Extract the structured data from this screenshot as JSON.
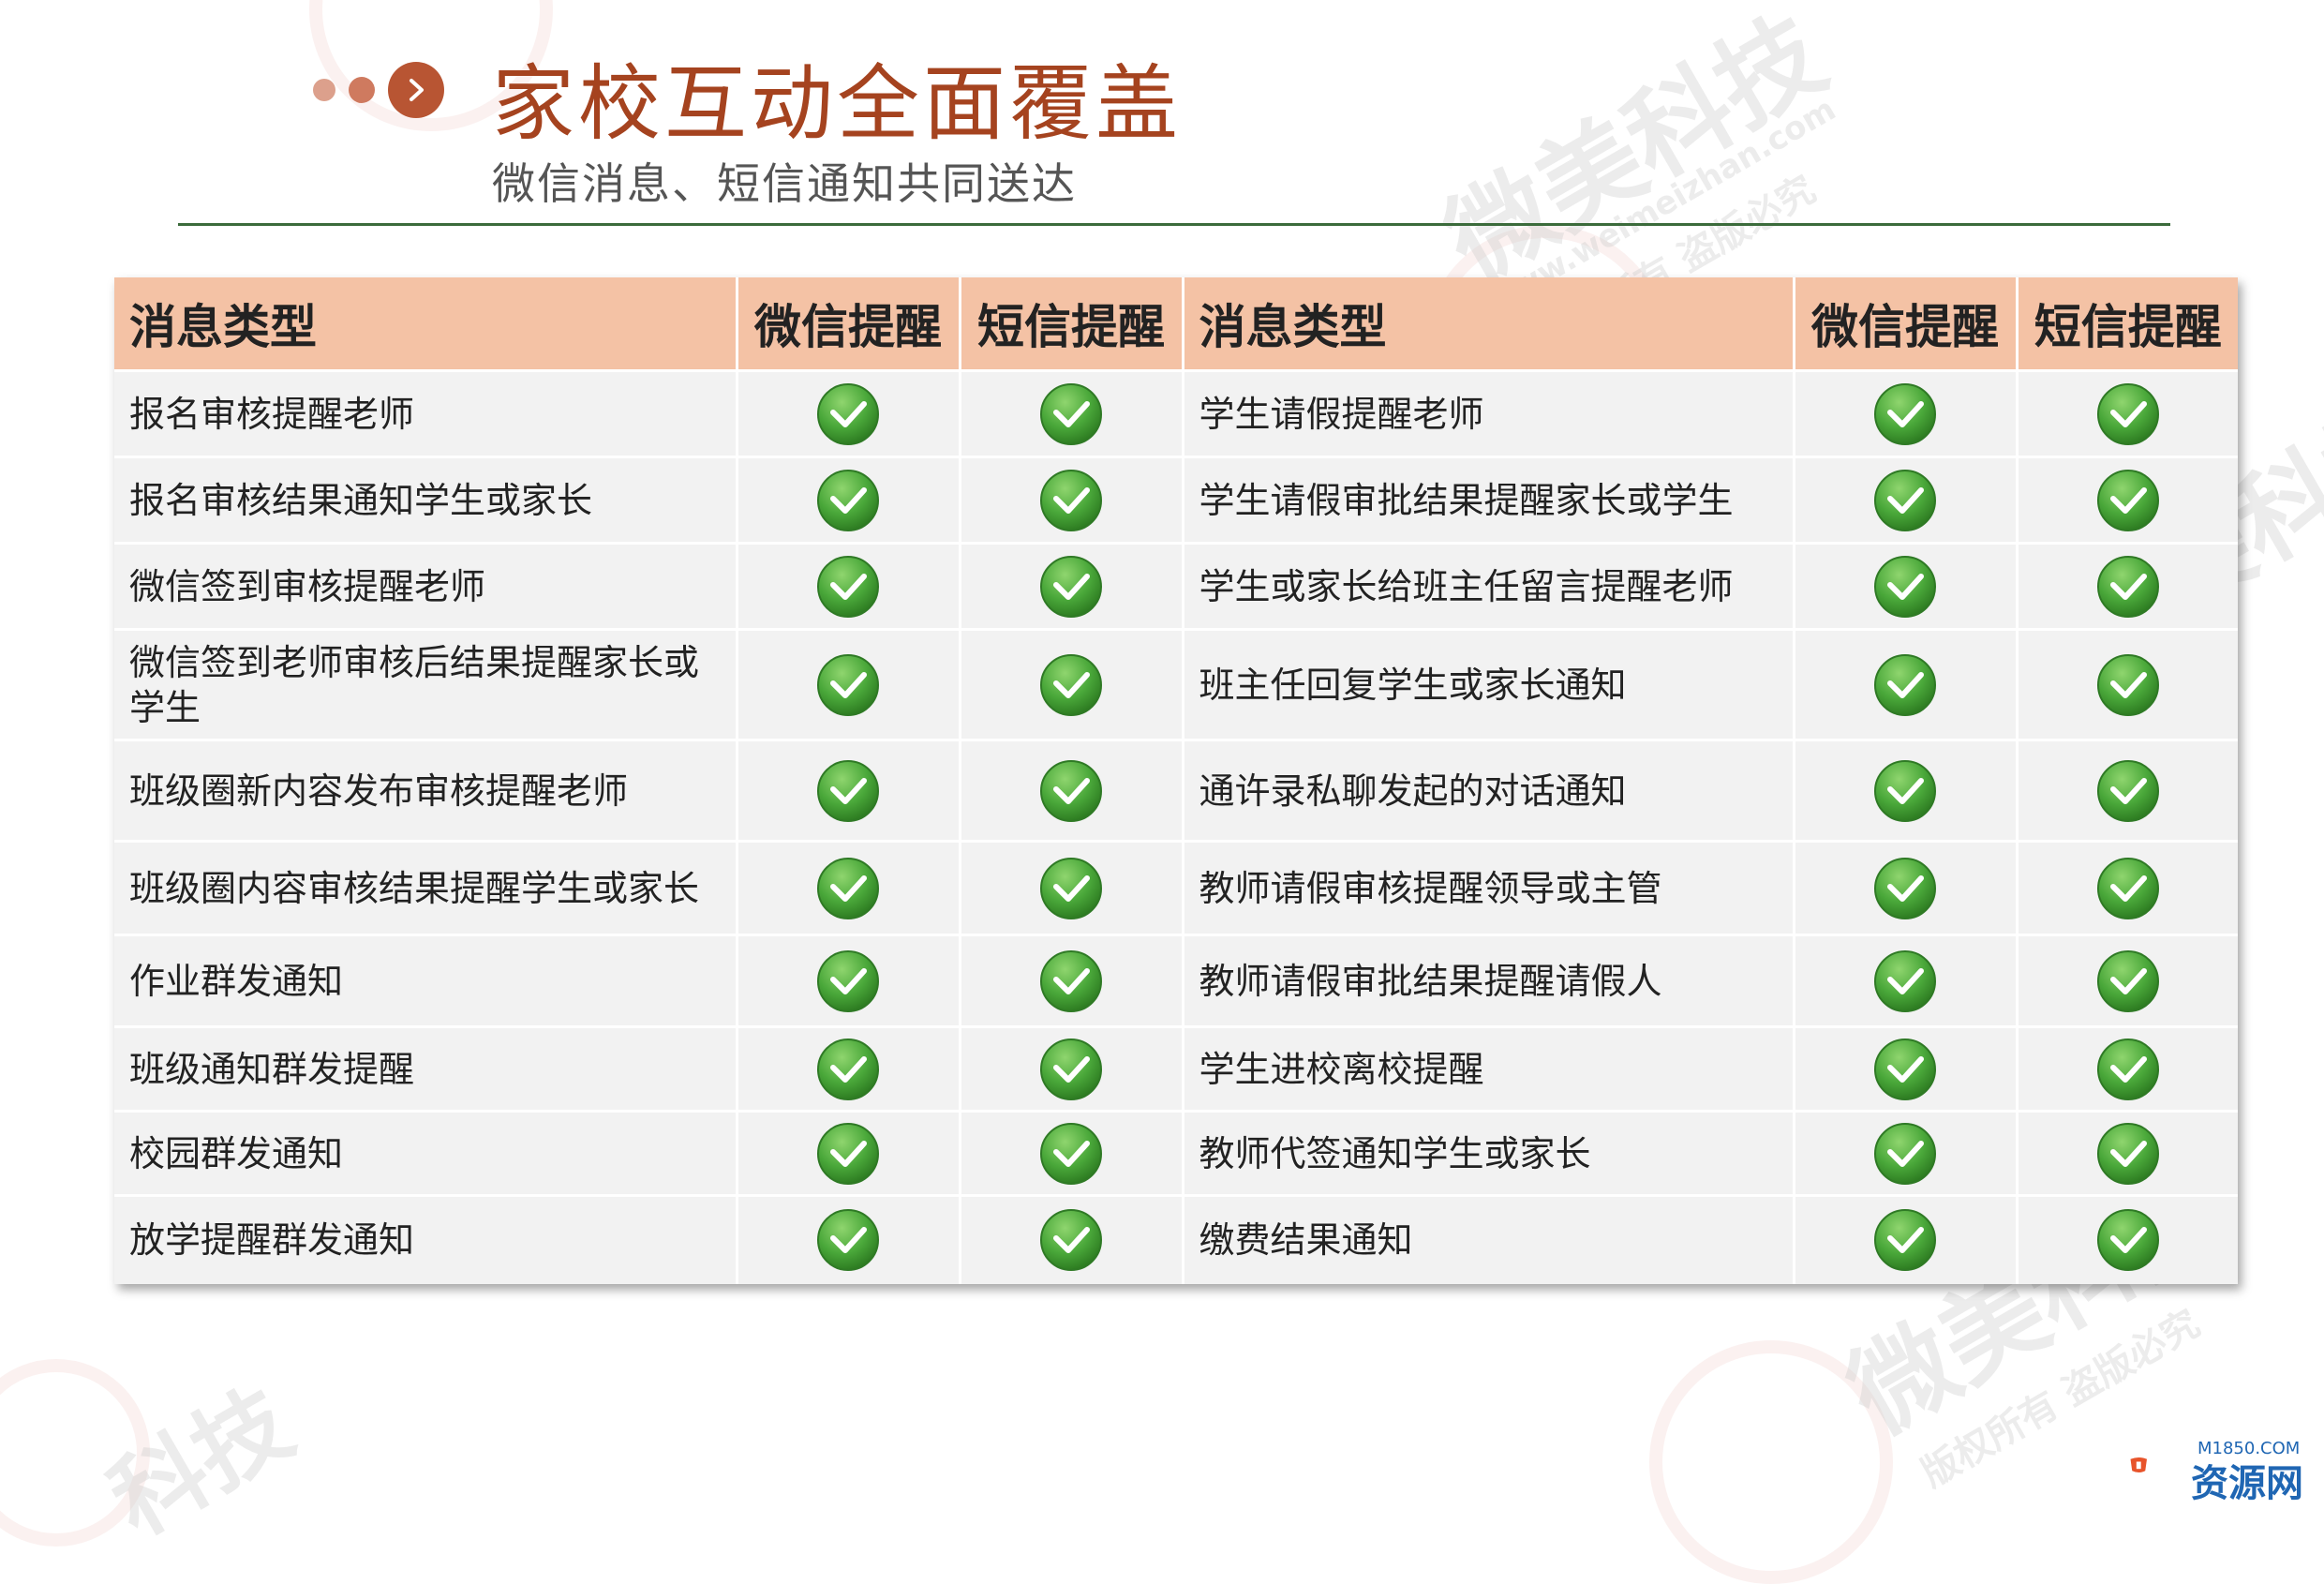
{
  "header": {
    "title": "家校互动全面覆盖",
    "subtitle": "微信消息、短信通知共同送达"
  },
  "table": {
    "headers": [
      "消息类型",
      "微信提醒",
      "短信提醒",
      "消息类型",
      "微信提醒",
      "短信提醒"
    ],
    "rows": [
      {
        "left": "报名审核提醒老师",
        "right": "学生请假提醒老师"
      },
      {
        "left": "报名审核结果通知学生或家长",
        "right": "学生请假审批结果提醒家长或学生"
      },
      {
        "left": "微信签到审核提醒老师",
        "right": "学生或家长给班主任留言提醒老师"
      },
      {
        "left": "微信签到老师审核后结果提醒家长或学生",
        "right": "班主任回复学生或家长通知"
      },
      {
        "left": "班级圈新内容发布审核提醒老师",
        "right": "通许录私聊发起的对话通知"
      },
      {
        "left": "班级圈内容审核结果提醒学生或家长",
        "right": "教师请假审核提醒领导或主管"
      },
      {
        "left": "作业群发通知",
        "right": "教师请假审批结果提醒请假人"
      },
      {
        "left": "班级通知群发提醒",
        "right": "学生进校离校提醒"
      },
      {
        "left": "校园群发通知",
        "right": "教师代签通知学生或家长"
      },
      {
        "left": "放学提醒群发通知",
        "right": "缴费结果通知"
      }
    ],
    "check_icon": "green-checkmark-icon"
  },
  "watermark": {
    "text_main": "微美科技",
    "text_url": "www.weimeizhan.com",
    "text_rights": "版权所有 盗版必究",
    "text_partial": "科技"
  },
  "corner_logo": {
    "name": "资源网",
    "url": "M1850.COM"
  },
  "colors": {
    "title": "#a5431f",
    "header_bg": "#f4c2a5",
    "row_bg": "#f2f2f2",
    "check_green": "#4aa83a",
    "divider": "#3b6b3b"
  }
}
